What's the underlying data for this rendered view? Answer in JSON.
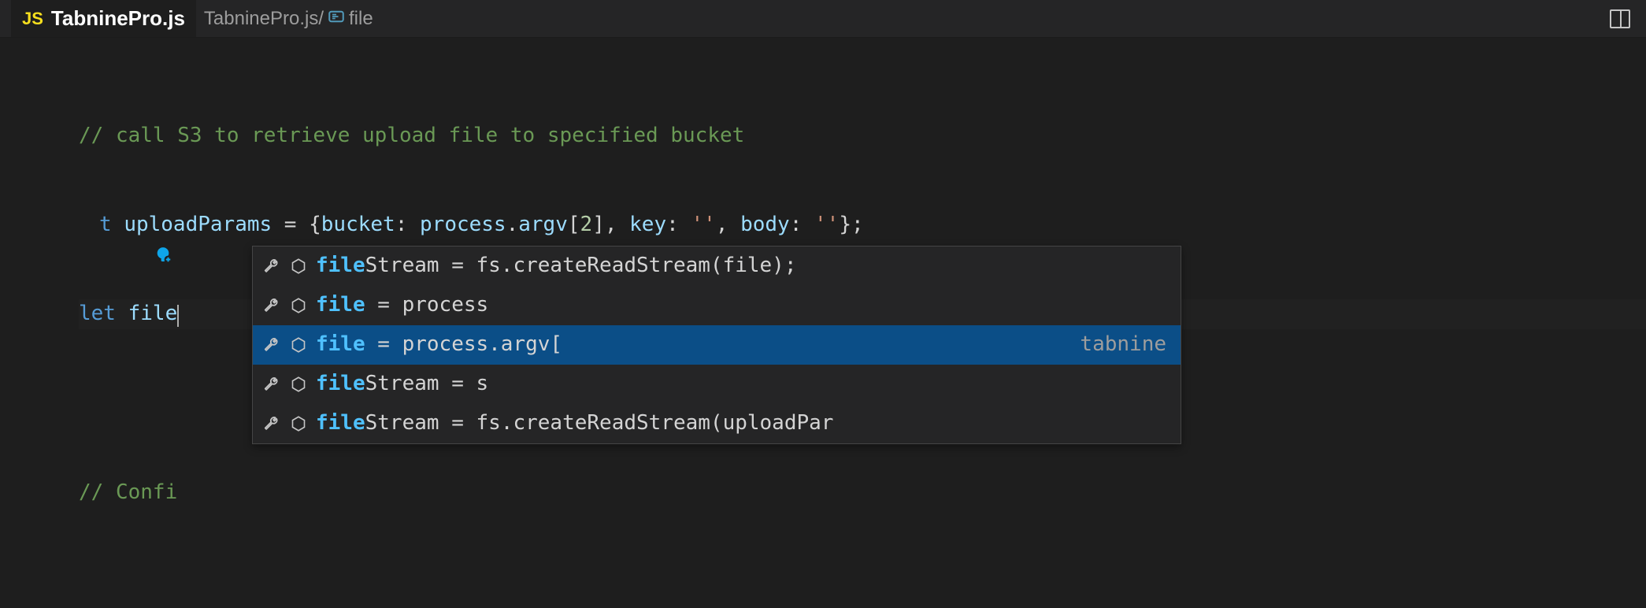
{
  "tab": {
    "icon_label": "JS",
    "title": "TabninePro.js"
  },
  "breadcrumb": {
    "path": "TabninePro.js/",
    "segment": "file"
  },
  "code": {
    "comment1": "// call S3 to retrieve upload file to specified bucket",
    "kw_let1_tail": "t",
    "upload_ident": "uploadParams",
    "eq": " = ",
    "open_brace": "{",
    "bucket_key": "bucket",
    "colon": ": ",
    "process": "process",
    "dot": ".",
    "argv": "argv",
    "idx_open": "[",
    "idx_num": "2",
    "idx_close": "]",
    "comma": ", ",
    "key_key": "key",
    "empty_str": "''",
    "body_key": "body",
    "close_brace": "};",
    "kw_let2": "let",
    "file_ident": "file",
    "comment2_prefix": "// Confi"
  },
  "suggest": {
    "provider": "tabnine",
    "items": [
      {
        "highlight": "file",
        "rest": "Stream = fs.createReadStream(file);",
        "selected": false
      },
      {
        "highlight": "file",
        "rest": " = process",
        "selected": false
      },
      {
        "highlight": "file",
        "rest": " = process.argv[",
        "selected": true
      },
      {
        "highlight": "file",
        "rest": "Stream = s",
        "selected": false
      },
      {
        "highlight": "file",
        "rest": "Stream = fs.createReadStream(uploadPar",
        "selected": false
      }
    ]
  }
}
